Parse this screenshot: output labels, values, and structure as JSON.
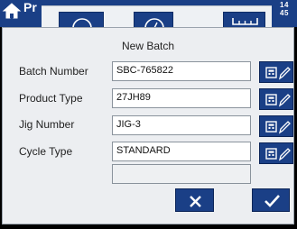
{
  "header": {
    "app_abbrev": "Pr",
    "counter_top": "14",
    "counter_bottom": "45",
    "home_icon": "home-icon",
    "toolbar_icons": [
      "dial-icon",
      "gauge-icon",
      "tray-icon"
    ]
  },
  "dialog": {
    "title": "New Batch",
    "fields": [
      {
        "label": "Batch Number",
        "value": "SBC-765822"
      },
      {
        "label": "Product Type",
        "value": "27JH89"
      },
      {
        "label": "Jig Number",
        "value": "JIG-3"
      },
      {
        "label": "Cycle Type",
        "value": "STANDARD"
      }
    ],
    "extra_field": {
      "value": ""
    },
    "edit_icon": "keypad-pencil-icon",
    "cancel_icon": "close-icon",
    "ok_icon": "checkmark-icon"
  },
  "colors": {
    "bar_blue": "#1a3f86",
    "dialog_bg": "#eceef1",
    "toolbar_bg": "#eef1f4"
  }
}
